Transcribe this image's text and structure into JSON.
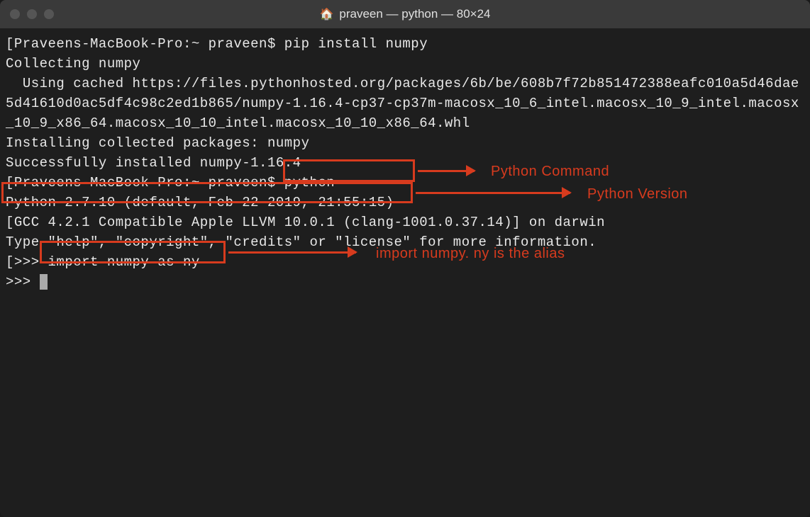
{
  "window": {
    "title": "praveen — python — 80×24"
  },
  "terminal": {
    "lines": [
      "[Praveens-MacBook-Pro:~ praveen$ pip install numpy",
      "Collecting numpy",
      "  Using cached https://files.pythonhosted.org/packages/6b/be/608b7f72b851472388eafc010a5d46dae5d41610d0ac5df4c98c2ed1b865/numpy-1.16.4-cp37-cp37m-macosx_10_6_intel.macosx_10_9_intel.macosx_10_9_x86_64.macosx_10_10_intel.macosx_10_10_x86_64.whl",
      "Installing collected packages: numpy",
      "Successfully installed numpy-1.16.4",
      "[Praveens-MacBook-Pro:~ praveen$ python",
      "Python 2.7.10 (default, Feb 22 2019, 21:55:15)",
      "[GCC 4.2.1 Compatible Apple LLVM 10.0.1 (clang-1001.0.37.14)] on darwin",
      "Type \"help\", \"copyright\", \"credits\" or \"license\" for more information.",
      "[>>> import numpy as ny",
      ">>> "
    ]
  },
  "annotations": {
    "python_cmd": "Python Command",
    "python_ver": "Python Version",
    "import_note": "import numpy. ny is the alias"
  }
}
